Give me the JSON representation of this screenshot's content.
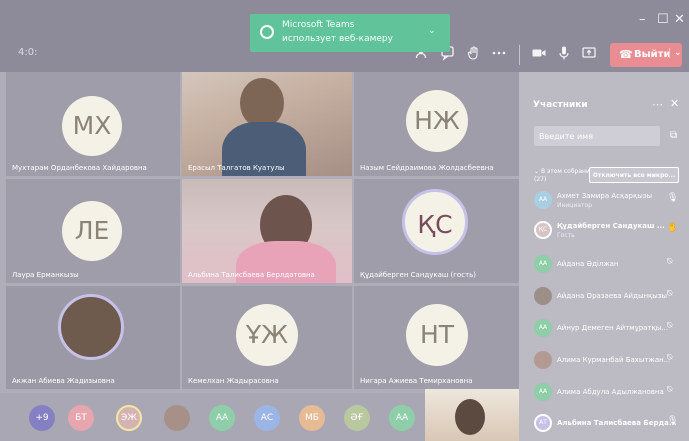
{
  "window": {
    "minimize": "–",
    "maximize": "☐",
    "close": "✕"
  },
  "toolbar": {
    "timer": "4:0:",
    "leave_label": "Выйти",
    "icons": [
      "people-icon",
      "chat-icon",
      "raise-hand-icon",
      "more-icon",
      "camera-icon",
      "mic-icon",
      "share-screen-icon"
    ]
  },
  "toast": {
    "title": "Microsoft Teams",
    "message": "использует веб-камеру"
  },
  "stage": {
    "tiles": [
      {
        "initials": "МХ",
        "name": "Мухтарам Орданбекова Хайдаровна"
      },
      {
        "initials": "",
        "name": "Ерасыл Талгатов Куатулы"
      },
      {
        "initials": "НЖ",
        "name": "Назым Сейдраимова Жолдасбеевна"
      },
      {
        "initials": "ЛЕ",
        "name": "Лаура Ерманкызы"
      },
      {
        "initials": "",
        "name": "Альбина Талисбаева Берлдатовна"
      },
      {
        "initials": "ҚС",
        "name": "Құдайберген Сандукаш (гость)"
      },
      {
        "initials": "",
        "name": "Акжан Абиева Жадизыовна"
      },
      {
        "initials": "ҰЖ",
        "name": "Кемелхан Жадырасовна"
      },
      {
        "initials": "НТ",
        "name": "Нигара Ажиева Темирхановна"
      }
    ],
    "strip": [
      "+9",
      "БТ",
      "ЭЖ",
      "",
      "АА",
      "АС",
      "МБ",
      "ӘҒ",
      "АА"
    ]
  },
  "panel": {
    "title": "Участники",
    "invite_placeholder": "Введите имя",
    "section_line1": "В этом собрании",
    "section_line2": "(27)",
    "mute_all": "Отключить все микро...",
    "participants": [
      {
        "initials": "АА",
        "name": "Ахмет Замира Асқарқызы",
        "role": "Инициатор"
      },
      {
        "initials": "ҚС",
        "name": "Құдайберген Сандукаш ...",
        "role": "Гость"
      },
      {
        "initials": "АА",
        "name": "Айдана Әділжан",
        "role": ""
      },
      {
        "initials": "",
        "name": "Айдана Оразаева Айдынқызы",
        "role": ""
      },
      {
        "initials": "АА",
        "name": "Айнур Демеген Айтмұратқы...",
        "role": ""
      },
      {
        "initials": "",
        "name": "Алима Курманбай Бахытжан...",
        "role": ""
      },
      {
        "initials": "АА",
        "name": "Алима Абдула Адылжановна",
        "role": ""
      },
      {
        "initials": "АТ",
        "name": "Альбина Талисбаева Берда...",
        "role": ""
      }
    ]
  },
  "colors": {
    "accent": "#61c39a",
    "leave": "#e98d92",
    "titlebar": "#8d8a99"
  }
}
